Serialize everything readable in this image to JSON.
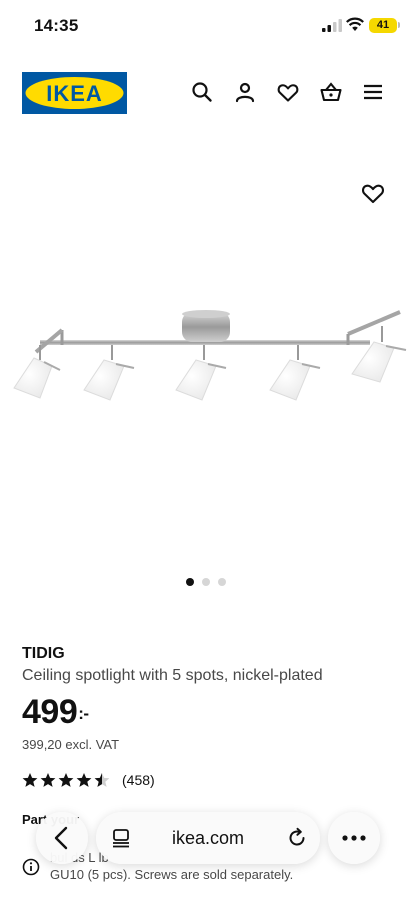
{
  "status_bar": {
    "time": "14:35",
    "battery": "41"
  },
  "header": {
    "logo_text": "IKEA",
    "icons": [
      "search-icon",
      "account-icon",
      "heart-icon",
      "basket-icon",
      "menu-icon"
    ]
  },
  "gallery": {
    "dots_count": 3,
    "active_dot": 1
  },
  "product": {
    "name": "TIDIG",
    "description": "Ceiling spotlight with 5 spots, nickel-plated",
    "price": "499",
    "price_suffix": ":-",
    "price_excl_vat": "399,20 excl. VAT",
    "rating": 4.5,
    "reviews": "(458)"
  },
  "notice": {
    "parts_label": "Part    your",
    "line1": "bul                                    ds L     lb",
    "line2": "GU10 (5 pcs). Screws are sold separately."
  },
  "browser": {
    "url": "ikea.com"
  },
  "colors": {
    "ikea_blue": "#0058a3",
    "ikea_yellow": "#ffdb00"
  }
}
